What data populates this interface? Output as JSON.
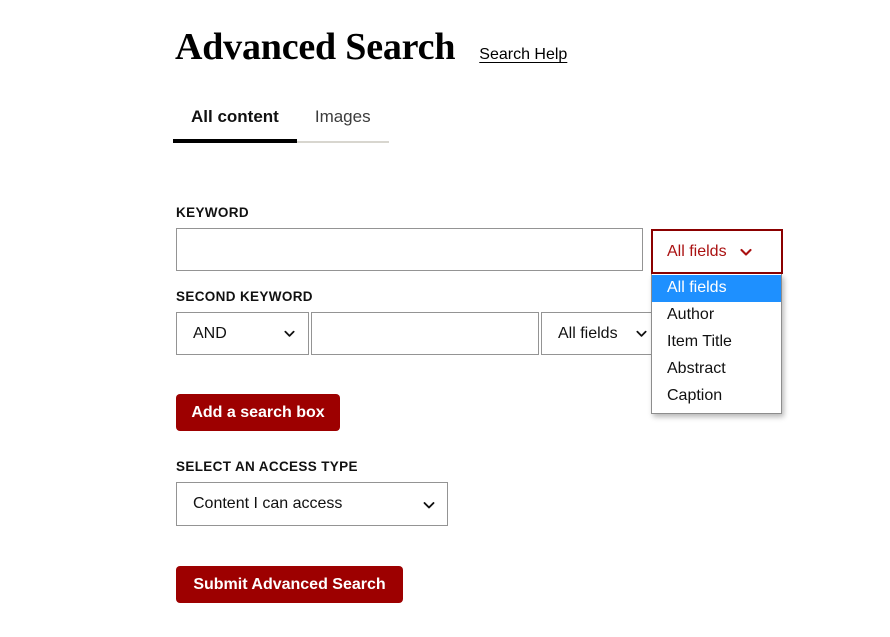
{
  "header": {
    "title": "Advanced Search",
    "help_link": "Search Help"
  },
  "tabs": [
    {
      "label": "All content",
      "active": true
    },
    {
      "label": "Images",
      "active": false
    }
  ],
  "form": {
    "keyword": {
      "label": "KEYWORD",
      "value": "",
      "placeholder": ""
    },
    "keyword_field_select": {
      "value": "All fields",
      "expanded": true,
      "options": [
        "All fields",
        "Author",
        "Item Title",
        "Abstract",
        "Caption"
      ],
      "highlighted_option": "All fields"
    },
    "second_keyword": {
      "label": "SECOND KEYWORD",
      "operator_value": "AND",
      "value": "",
      "placeholder": "",
      "field_value": "All fields"
    },
    "add_search_box_button": "Add a search box",
    "access_type": {
      "label": "SELECT AN ACCESS TYPE",
      "value": "Content I can access"
    },
    "submit_button": "Submit Advanced Search"
  },
  "colors": {
    "brand_red": "#9d0000",
    "focus_border_red": "#8b0000",
    "select_highlight_blue": "#1e90ff",
    "border_gray": "#949494"
  }
}
